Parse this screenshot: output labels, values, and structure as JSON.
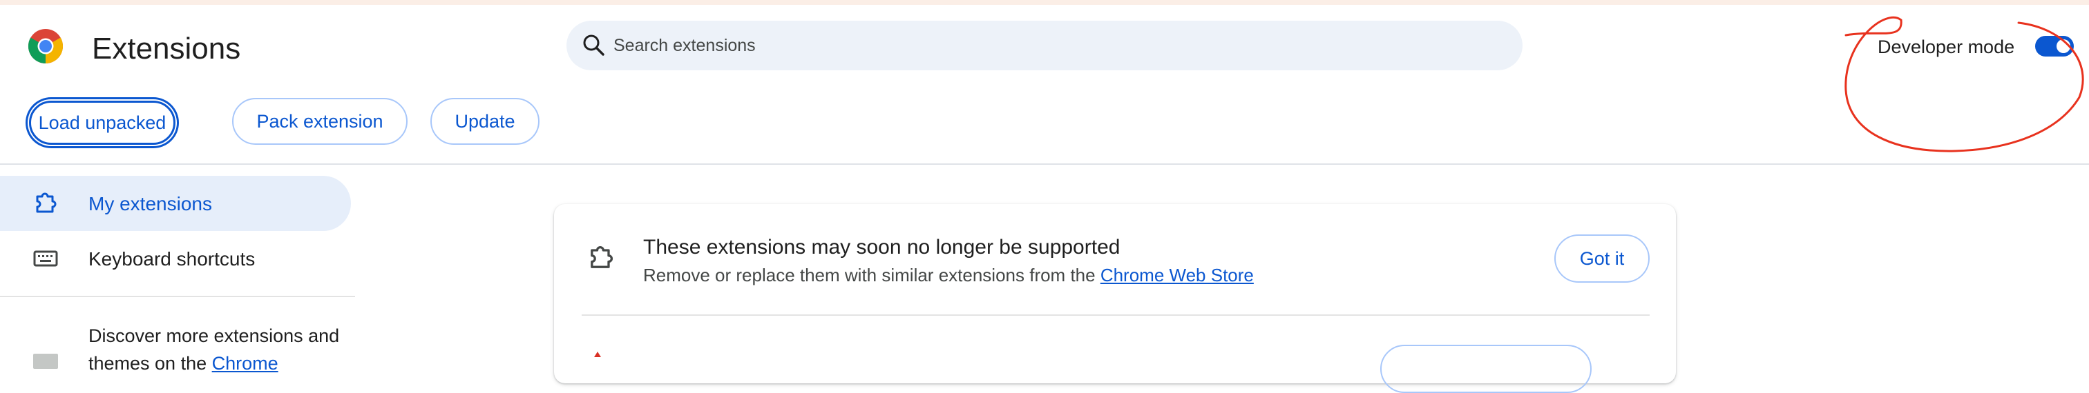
{
  "header": {
    "title": "Extensions",
    "search": {
      "placeholder": "Search extensions"
    },
    "developer_mode": {
      "label": "Developer mode",
      "enabled": true
    }
  },
  "toolbar": {
    "load_unpacked": "Load unpacked",
    "pack_extension": "Pack extension",
    "update": "Update"
  },
  "sidebar": {
    "items": [
      {
        "label": "My extensions",
        "icon": "extension-puzzle-icon",
        "active": true
      },
      {
        "label": "Keyboard shortcuts",
        "icon": "keyboard-icon",
        "active": false
      }
    ],
    "discover": {
      "text_before": "Discover more extensions and themes on the ",
      "link": "Chrome"
    }
  },
  "notice": {
    "icon": "extension-puzzle-icon",
    "title": "These extensions may soon no longer be supported",
    "description": "Remove or replace them with similar extensions from the ",
    "link": "Chrome Web Store",
    "button": "Got it"
  },
  "colors": {
    "accent": "#0b57d0",
    "annotation": "#e8321e",
    "search_bg": "#edf2f9",
    "active_nav_bg": "#e6eefa"
  }
}
